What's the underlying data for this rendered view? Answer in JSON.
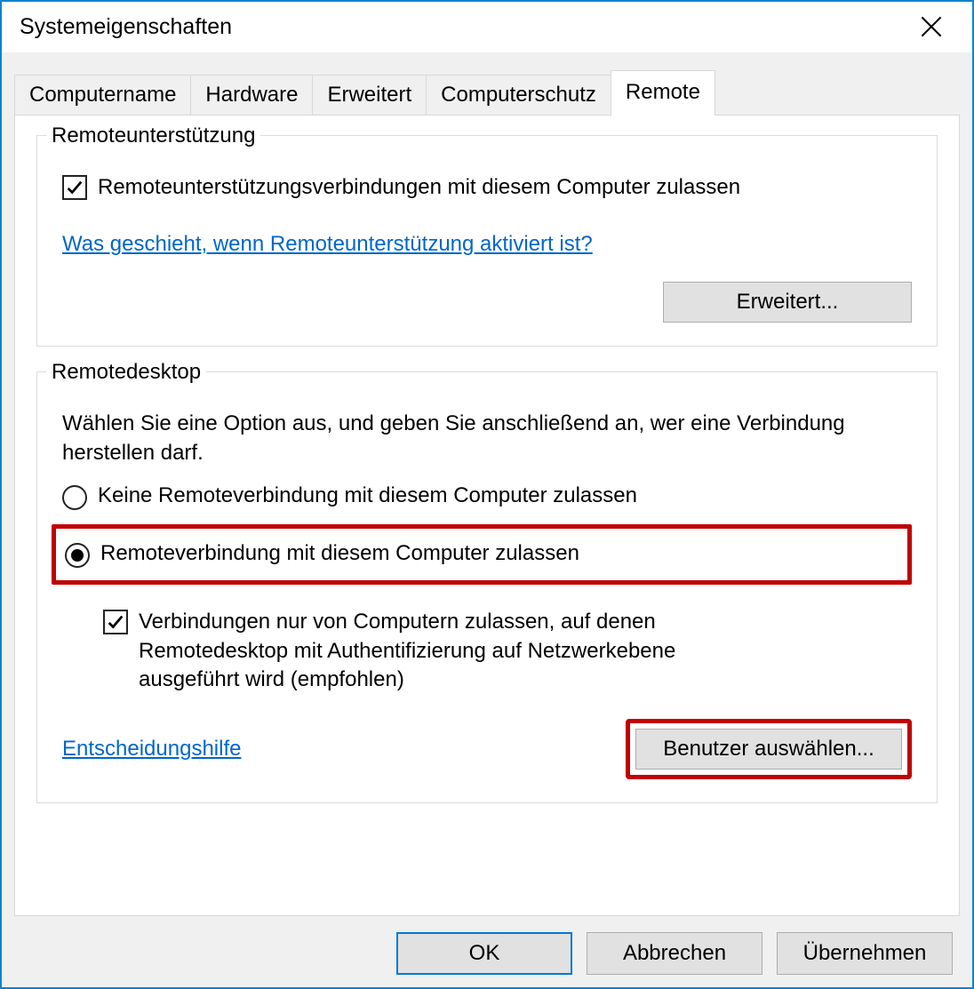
{
  "window": {
    "title": "Systemeigenschaften"
  },
  "tabs": {
    "computername": "Computername",
    "hardware": "Hardware",
    "erweitert": "Erweitert",
    "computerschutz": "Computerschutz",
    "remote": "Remote"
  },
  "group_remote_assist": {
    "legend": "Remoteunterstützung",
    "checkbox_label": "Remoteunterstützungsverbindungen mit diesem Computer zulassen",
    "help_link": "Was geschieht, wenn Remoteunterstützung aktiviert ist?",
    "advanced_button": "Erweitert..."
  },
  "group_remote_desktop": {
    "legend": "Remotedesktop",
    "intro": "Wählen Sie eine Option aus, und geben Sie anschließend an, wer eine Verbindung herstellen darf.",
    "option_disallow": "Keine Remoteverbindung mit diesem Computer zulassen",
    "option_allow": "Remoteverbindung mit diesem Computer zulassen",
    "nla_checkbox": "Verbindungen nur von Computern zulassen, auf denen Remotedesktop mit Authentifizierung auf Netzwerkebene ausgeführt wird (empfohlen)",
    "help_link": "Entscheidungshilfe",
    "select_users_button": "Benutzer auswählen..."
  },
  "footer": {
    "ok": "OK",
    "cancel": "Abbrechen",
    "apply": "Übernehmen"
  }
}
